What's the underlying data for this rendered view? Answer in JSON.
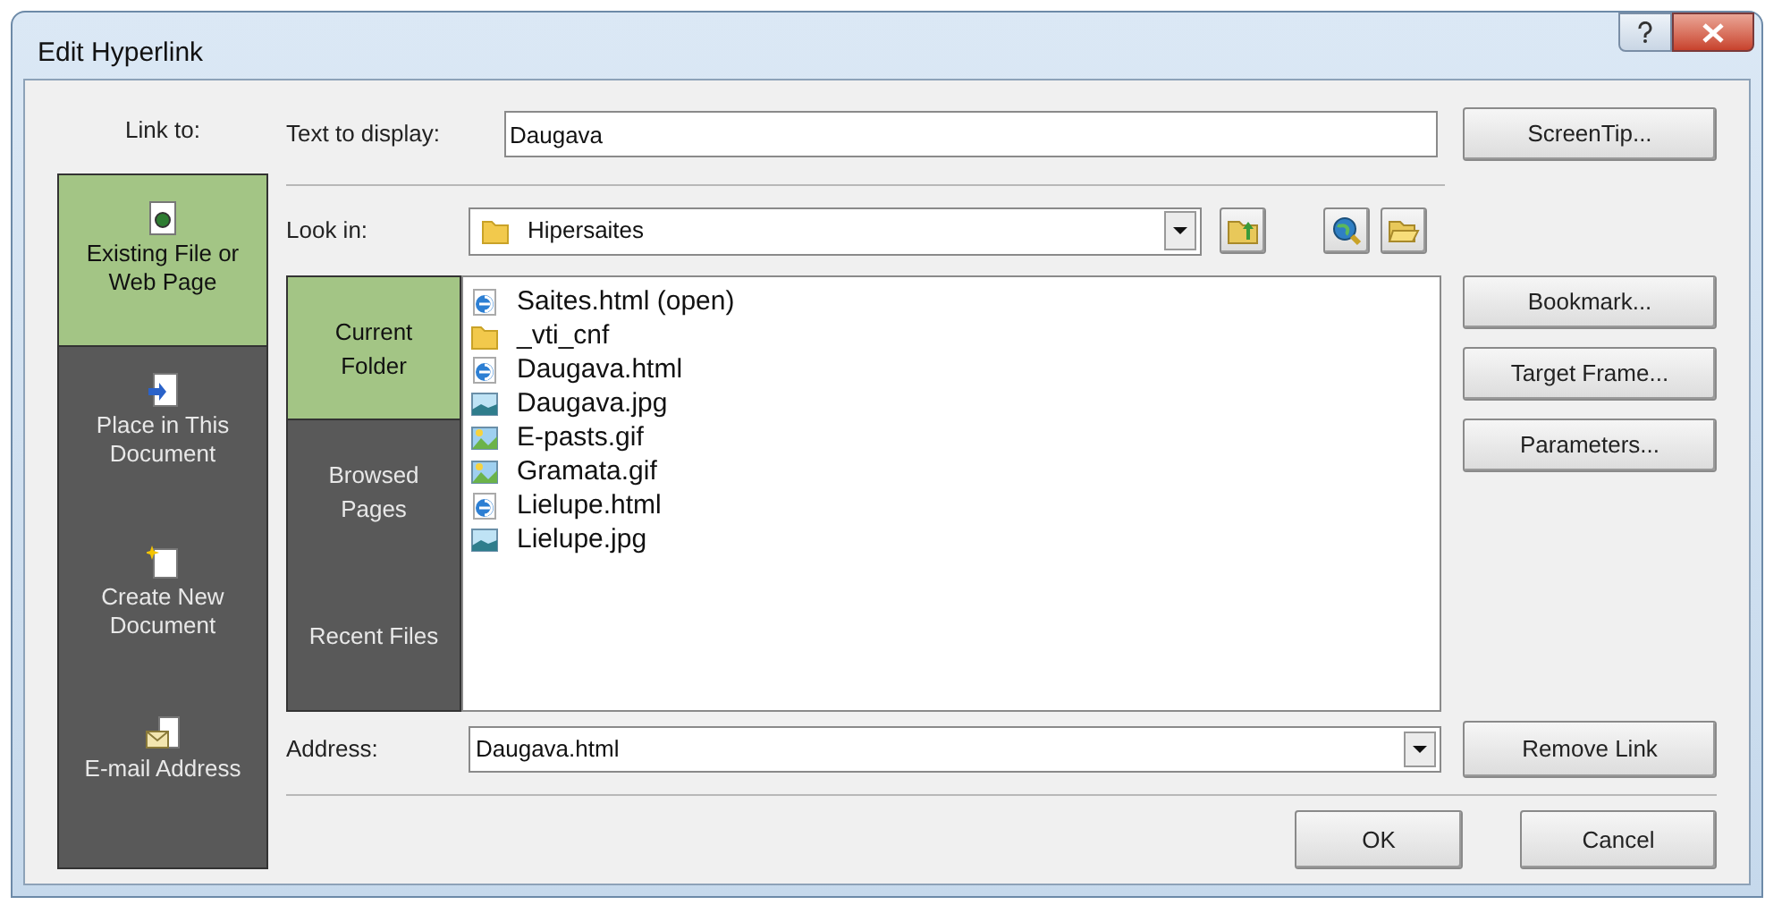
{
  "window": {
    "title": "Edit Hyperlink"
  },
  "link_to": {
    "label": "Link to:",
    "items": [
      {
        "label": "Existing File or Web Page",
        "kind": "file",
        "selected": true
      },
      {
        "label": "Place in This Document",
        "kind": "place",
        "selected": false
      },
      {
        "label": "Create New Document",
        "kind": "new",
        "selected": false
      },
      {
        "label": "E-mail Address",
        "kind": "email",
        "selected": false
      }
    ]
  },
  "text_to_display": {
    "label": "Text to display:",
    "value": "Daugava"
  },
  "screentip_button": "ScreenTip...",
  "look_in": {
    "label": "Look in:",
    "value": "Hipersaites"
  },
  "browse_nav": [
    {
      "label": "Current Folder",
      "selected": true
    },
    {
      "label": "Browsed Pages",
      "selected": false
    },
    {
      "label": "Recent Files",
      "selected": false
    }
  ],
  "files": [
    {
      "name": "Saites.html (open)",
      "kind": "html"
    },
    {
      "name": "_vti_cnf",
      "kind": "folder"
    },
    {
      "name": "Daugava.html",
      "kind": "html"
    },
    {
      "name": "Daugava.jpg",
      "kind": "jpg"
    },
    {
      "name": "E-pasts.gif",
      "kind": "gif"
    },
    {
      "name": "Gramata.gif",
      "kind": "gif"
    },
    {
      "name": "Lielupe.html",
      "kind": "html"
    },
    {
      "name": "Lielupe.jpg",
      "kind": "jpg"
    }
  ],
  "side_buttons": [
    "Bookmark...",
    "Target Frame...",
    "Parameters..."
  ],
  "address": {
    "label": "Address:",
    "value": "Daugava.html"
  },
  "remove_link_button": "Remove Link",
  "buttons": [
    "OK",
    "Cancel"
  ]
}
